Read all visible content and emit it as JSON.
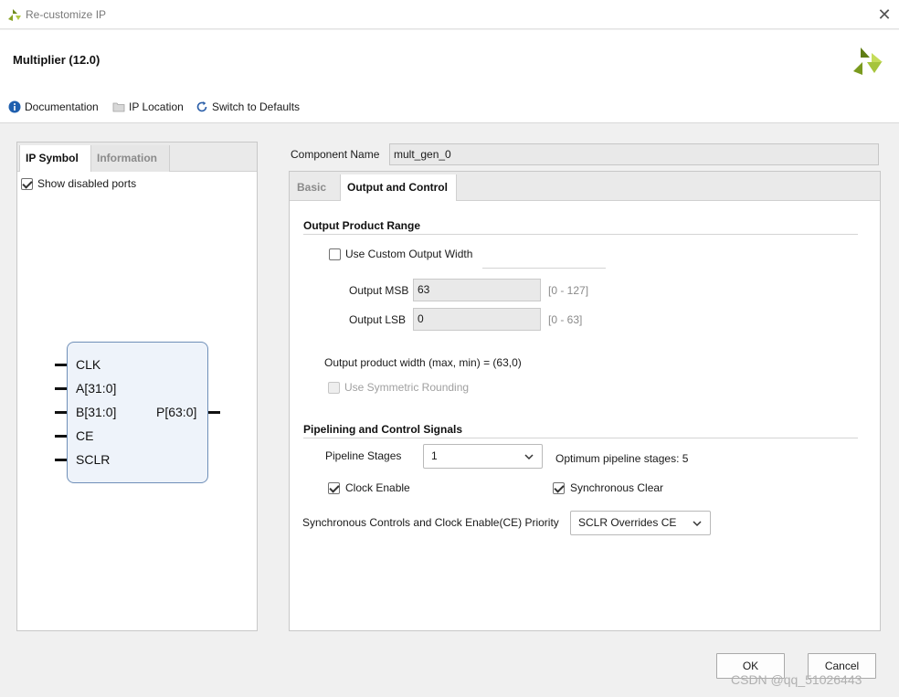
{
  "window": {
    "title": "Re-customize IP",
    "close_icon": "close-icon"
  },
  "header": {
    "ip_name": "Multiplier (12.0)"
  },
  "toolbar": {
    "documentation": "Documentation",
    "ip_location": "IP Location",
    "switch_defaults": "Switch to Defaults"
  },
  "left": {
    "tabs": [
      {
        "label": "IP Symbol"
      },
      {
        "label": "Information"
      }
    ],
    "show_disabled_ports": {
      "label": "Show disabled ports",
      "checked": true
    },
    "symbol": {
      "inputs": [
        "CLK",
        "A[31:0]",
        "B[31:0]",
        "CE",
        "SCLR"
      ],
      "outputs": [
        "P[63:0]"
      ]
    }
  },
  "component": {
    "label": "Component Name",
    "value": "mult_gen_0"
  },
  "right": {
    "tabs": [
      {
        "label": "Basic"
      },
      {
        "label": "Output and Control"
      }
    ],
    "output_range": {
      "title": "Output Product Range",
      "custom_width": {
        "label": "Use Custom Output Width",
        "checked": false
      },
      "msb": {
        "label": "Output MSB",
        "value": "63",
        "range": "[0 - 127]"
      },
      "lsb": {
        "label": "Output LSB",
        "value": "0",
        "range": "[0 - 63]"
      },
      "width_text": "Output product width (max, min) = (63,0)",
      "symmetric": {
        "label": "Use Symmetric Rounding",
        "checked": false
      }
    },
    "pipeline": {
      "title": "Pipelining and Control Signals",
      "stages_label": "Pipeline Stages",
      "stages_value": "1",
      "optimum": "Optimum pipeline stages: 5",
      "clock_enable": {
        "label": "Clock Enable",
        "checked": true
      },
      "sync_clear": {
        "label": "Synchronous Clear",
        "checked": true
      },
      "priority_label": "Synchronous Controls and Clock Enable(CE) Priority",
      "priority_value": "SCLR Overrides CE"
    }
  },
  "buttons": {
    "ok": "OK",
    "cancel": "Cancel"
  },
  "watermark": "CSDN @qq_51026443"
}
